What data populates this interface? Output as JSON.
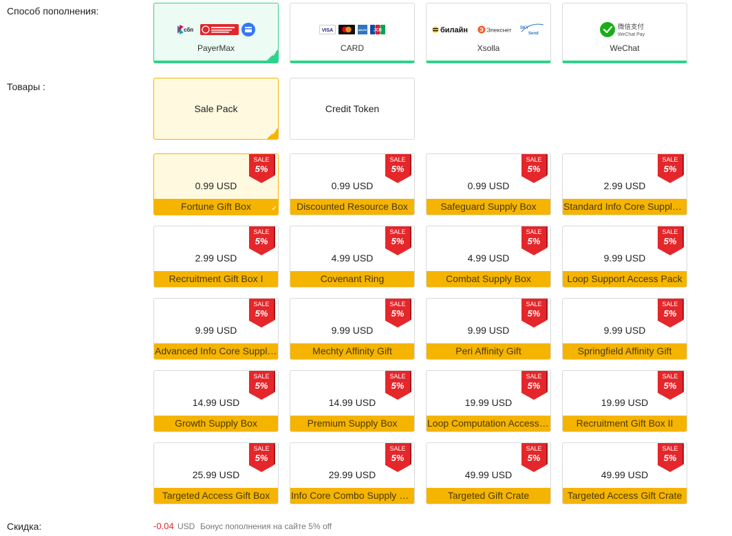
{
  "labels": {
    "payment_method": "Способ пополнения:",
    "goods": "Товары :",
    "discount": "Скидка:"
  },
  "payment_methods": [
    {
      "name": "PayerMax",
      "logos": [
        "sbp-logo",
        "cbr-ruble-logo",
        "card-logo"
      ],
      "selected": true
    },
    {
      "name": "CARD",
      "logos": [
        "visa-logo",
        "mastercard-logo",
        "amex-logo",
        "jcb-logo"
      ],
      "selected": false
    },
    {
      "name": "Xsolla",
      "logos": [
        "beeline-logo",
        "elexnet-logo",
        "skysend-logo"
      ],
      "selected": false
    },
    {
      "name": "WeChat",
      "logos": [
        "wechat-pay-logo"
      ],
      "selected": false
    }
  ],
  "payment_logo_text": {
    "sbp": "сбп",
    "visa": "VISA",
    "amex": "AM EX",
    "jcb": "JCB",
    "beeline": "билайн",
    "elexnet": "Элекснет",
    "skysend_top": "SKY",
    "skysend_bottom": "Send",
    "wechat_cn": "微信支付",
    "wechat_en": "WeChat Pay"
  },
  "goods_types": [
    {
      "label": "Sale Pack",
      "selected": true
    },
    {
      "label": "Credit Token",
      "selected": false
    }
  ],
  "sale_badge": {
    "top": "SALE",
    "bottom": "5%"
  },
  "products": [
    {
      "price": "0.99 USD",
      "name": "Fortune Gift Box",
      "selected": true
    },
    {
      "price": "0.99 USD",
      "name": "Discounted Resource Box",
      "selected": false
    },
    {
      "price": "0.99 USD",
      "name": "Safeguard Supply Box",
      "selected": false
    },
    {
      "price": "2.99 USD",
      "name": "Standard Info Core Supply Box",
      "selected": false
    },
    {
      "price": "2.99 USD",
      "name": "Recruitment Gift Box I",
      "selected": false
    },
    {
      "price": "4.99 USD",
      "name": "Covenant Ring",
      "selected": false
    },
    {
      "price": "4.99 USD",
      "name": "Combat Supply Box",
      "selected": false
    },
    {
      "price": "9.99 USD",
      "name": "Loop Support Access Pack",
      "selected": false
    },
    {
      "price": "9.99 USD",
      "name": "Advanced Info Core Supply Box",
      "selected": false
    },
    {
      "price": "9.99 USD",
      "name": "Mechty Affinity Gift",
      "selected": false
    },
    {
      "price": "9.99 USD",
      "name": "Peri Affinity Gift",
      "selected": false
    },
    {
      "price": "9.99 USD",
      "name": "Springfield Affinity Gift",
      "selected": false
    },
    {
      "price": "14.99 USD",
      "name": "Growth Supply Box",
      "selected": false
    },
    {
      "price": "14.99 USD",
      "name": "Premium Supply Box",
      "selected": false
    },
    {
      "price": "19.99 USD",
      "name": "Loop Computation Access Pack",
      "selected": false
    },
    {
      "price": "19.99 USD",
      "name": "Recruitment Gift Box II",
      "selected": false
    },
    {
      "price": "25.99 USD",
      "name": "Targeted Access Gift Box",
      "selected": false
    },
    {
      "price": "29.99 USD",
      "name": "Info Core Combo Supply Box",
      "selected": false
    },
    {
      "price": "49.99 USD",
      "name": "Targeted Gift Crate",
      "selected": false
    },
    {
      "price": "49.99 USD",
      "name": "Targeted Access Gift Crate",
      "selected": false
    }
  ],
  "discount": {
    "value": "-0.04",
    "currency": "USD",
    "note": "Бонус пополнения на сайте 5% off"
  },
  "colors": {
    "green_accent": "#2fd28a",
    "gold_accent": "#f5b400",
    "sale_red": "#e5262a",
    "discount_red": "#e5262a"
  }
}
